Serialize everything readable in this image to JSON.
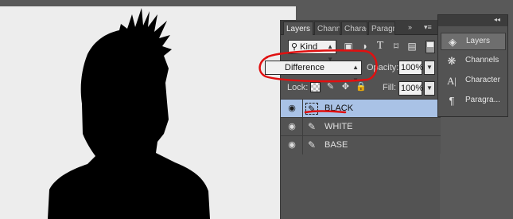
{
  "layers_panel": {
    "tabs": [
      "Layers",
      "Channe",
      "Charac",
      "Paragr"
    ],
    "tab_overflow": "»",
    "tab_menu": "▾≡",
    "filter": {
      "kind_label": "Kind",
      "icons": [
        "image-filter-icon",
        "adjustment-filter-icon",
        "type-filter-icon",
        "shape-filter-icon",
        "smart-object-filter-icon"
      ]
    },
    "blend_mode": "Difference",
    "opacity_label": "Opacity:",
    "opacity_value": "100%",
    "lock_label": "Lock:",
    "fill_label": "Fill:",
    "fill_value": "100%",
    "layers": [
      {
        "name": "BLACK",
        "selected": true
      },
      {
        "name": "WHITE",
        "selected": false
      },
      {
        "name": "BASE",
        "selected": false
      }
    ]
  },
  "dock": {
    "items": [
      {
        "label": "Layers",
        "icon": "layers-icon",
        "active": true
      },
      {
        "label": "Channels",
        "icon": "channels-icon",
        "active": false
      },
      {
        "label": "Character",
        "icon": "character-icon",
        "active": false
      },
      {
        "label": "Paragra...",
        "icon": "paragraph-icon",
        "active": false
      }
    ]
  },
  "colors": {
    "selection": "#a9c2e6",
    "annotation": "#e01010",
    "canvas": "#ededed",
    "panel": "#535353"
  }
}
